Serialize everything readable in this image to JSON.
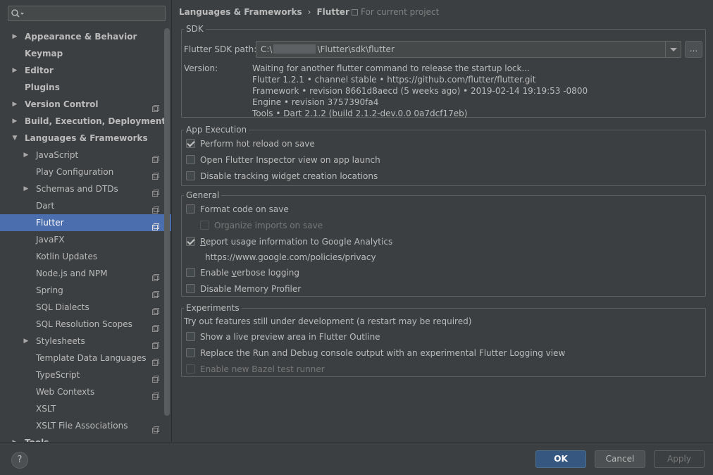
{
  "search": {
    "placeholder": ""
  },
  "sidebar": {
    "items": [
      {
        "label": "Appearance & Behavior",
        "arrow": "▶",
        "level": 0
      },
      {
        "label": "Keymap",
        "arrow": "",
        "level": 0
      },
      {
        "label": "Editor",
        "arrow": "▶",
        "level": 0
      },
      {
        "label": "Plugins",
        "arrow": "",
        "level": 0
      },
      {
        "label": "Version Control",
        "arrow": "▶",
        "level": 0,
        "project": true
      },
      {
        "label": "Build, Execution, Deployment",
        "arrow": "▶",
        "level": 0
      },
      {
        "label": "Languages & Frameworks",
        "arrow": "▼",
        "level": 0
      },
      {
        "label": "JavaScript",
        "arrow": "▶",
        "level": 1,
        "project": true
      },
      {
        "label": "Play Configuration",
        "arrow": "",
        "level": 1,
        "project": true
      },
      {
        "label": "Schemas and DTDs",
        "arrow": "▶",
        "level": 1,
        "project": true
      },
      {
        "label": "Dart",
        "arrow": "",
        "level": 1,
        "project": true
      },
      {
        "label": "Flutter",
        "arrow": "",
        "level": 1,
        "project": true,
        "selected": true
      },
      {
        "label": "JavaFX",
        "arrow": "",
        "level": 1
      },
      {
        "label": "Kotlin Updates",
        "arrow": "",
        "level": 1
      },
      {
        "label": "Node.js and NPM",
        "arrow": "",
        "level": 1,
        "project": true
      },
      {
        "label": "Spring",
        "arrow": "",
        "level": 1,
        "project": true
      },
      {
        "label": "SQL Dialects",
        "arrow": "",
        "level": 1,
        "project": true
      },
      {
        "label": "SQL Resolution Scopes",
        "arrow": "",
        "level": 1,
        "project": true
      },
      {
        "label": "Stylesheets",
        "arrow": "▶",
        "level": 1,
        "project": true
      },
      {
        "label": "Template Data Languages",
        "arrow": "",
        "level": 1,
        "project": true
      },
      {
        "label": "TypeScript",
        "arrow": "",
        "level": 1,
        "project": true
      },
      {
        "label": "Web Contexts",
        "arrow": "",
        "level": 1,
        "project": true
      },
      {
        "label": "XSLT",
        "arrow": "",
        "level": 1
      },
      {
        "label": "XSLT File Associations",
        "arrow": "",
        "level": 1,
        "project": true
      },
      {
        "label": "Tools",
        "arrow": "▶",
        "level": 0
      }
    ]
  },
  "breadcrumb": {
    "parent": "Languages & Frameworks",
    "separator": "›",
    "current": "Flutter",
    "scope": "For current project"
  },
  "sdk": {
    "title": "SDK",
    "path_label": "Flutter SDK path:",
    "path_prefix": "C:\\",
    "path_suffix": "\\Flutter\\sdk\\flutter",
    "browse_label": "...",
    "version_label": "Version:",
    "version_lines": [
      "Waiting for another flutter command to release the startup lock...",
      "Flutter 1.2.1 • channel stable • https://github.com/flutter/flutter.git",
      "Framework • revision 8661d8aecd (5 weeks ago) • 2019-02-14 19:19:53 -0800",
      "Engine • revision 3757390fa4",
      "Tools • Dart 2.1.2 (build 2.1.2-dev.0.0 0a7dcf17eb)"
    ]
  },
  "app_execution": {
    "title": "App Execution",
    "hot_reload": {
      "label": "Perform hot reload on save",
      "checked": true
    },
    "inspector": {
      "label": "Open Flutter Inspector view on app launch",
      "checked": false
    },
    "tracking": {
      "label": "Disable tracking widget creation locations",
      "checked": false
    }
  },
  "general": {
    "title": "General",
    "format": {
      "label": "Format code on save",
      "checked": false
    },
    "organize": {
      "label": "Organize imports on save",
      "checked": false
    },
    "analytics": {
      "label_underlined": "R",
      "label_rest": "eport usage information to Google Analytics",
      "checked": true
    },
    "privacy_url": "https://www.google.com/policies/privacy",
    "verbose": {
      "label_pre": "Enable ",
      "label_underlined": "v",
      "label_rest": "erbose logging",
      "checked": false
    },
    "memory": {
      "label": "Disable Memory Profiler",
      "checked": false
    }
  },
  "experiments": {
    "title": "Experiments",
    "description": "Try out features still under development (a restart may be required)",
    "preview": {
      "label": "Show a live preview area in Flutter Outline",
      "checked": false
    },
    "logging": {
      "label": "Replace the Run and Debug console output with an experimental Flutter Logging view",
      "checked": false
    },
    "bazel": {
      "label": "Enable new Bazel test runner",
      "checked": false
    }
  },
  "footer": {
    "help": "?",
    "ok": "OK",
    "cancel": "Cancel",
    "apply": "Apply"
  },
  "colors": {
    "selection": "#4b6eaf",
    "background": "#3c3f41",
    "ok_button": "#365880"
  }
}
